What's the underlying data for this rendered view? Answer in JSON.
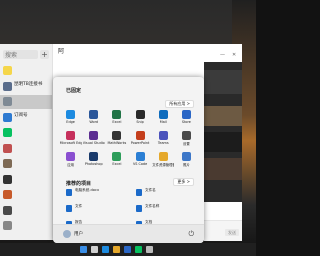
{
  "chat": {
    "search_placeholder": "搜索",
    "add_label": "+",
    "header_title": "阿",
    "send_label": "发送",
    "contacts": [
      {
        "name": "",
        "msg": "",
        "color": "#f5d64a"
      },
      {
        "name": "昆明TB连接书",
        "msg": "",
        "color": "#5a6d8c"
      },
      {
        "name": "",
        "msg": "",
        "color": "#7f8a95"
      },
      {
        "name": "订阅号",
        "msg": "",
        "color": "#2e7ad1"
      },
      {
        "name": "",
        "msg": "",
        "color": "#07c160"
      },
      {
        "name": "",
        "msg": "",
        "color": "#c05050"
      },
      {
        "name": "",
        "msg": "",
        "color": "#7e6a55"
      },
      {
        "name": "",
        "msg": "",
        "color": "#333333"
      },
      {
        "name": "",
        "msg": "",
        "color": "#c75a2a"
      },
      {
        "name": "",
        "msg": "",
        "color": "#4a4a4a"
      },
      {
        "name": "",
        "msg": "",
        "color": "#888888"
      }
    ]
  },
  "start_menu": {
    "pinned_label": "已固定",
    "all_apps_label": "所有应用 >",
    "pinned_apps": [
      {
        "label": "Edge",
        "color": "#1d8be0",
        "icon": "edge-icon"
      },
      {
        "label": "Word",
        "color": "#2b579a",
        "icon": "word-icon"
      },
      {
        "label": "Excel",
        "color": "#217346",
        "icon": "excel-icon"
      },
      {
        "label": "Snip",
        "color": "#2a2a2a",
        "icon": "snip-icon"
      },
      {
        "label": "Mail",
        "color": "#0f6cbd",
        "icon": "mail-icon"
      },
      {
        "label": "Store",
        "color": "#2b67c6",
        "icon": "store-icon"
      },
      {
        "label": "Microsoft Edge",
        "color": "#c6305c",
        "icon": "app-icon"
      },
      {
        "label": "Visual Studio",
        "color": "#5c2d91",
        "icon": "vs-icon"
      },
      {
        "label": "MathWorks",
        "color": "#343434",
        "icon": "app-icon"
      },
      {
        "label": "PowerPoint",
        "color": "#c43e1c",
        "icon": "powerpoint-icon"
      },
      {
        "label": "Teams",
        "color": "#4b53bc",
        "icon": "teams-icon"
      },
      {
        "label": "设置",
        "color": "#4a4a4a",
        "icon": "settings-icon"
      },
      {
        "label": "应用",
        "color": "#8a4fd0",
        "icon": "app-icon"
      },
      {
        "label": "Photoshop",
        "color": "#1a3a6b",
        "icon": "photoshop-icon"
      },
      {
        "label": "Excel",
        "color": "#2d9d5a",
        "icon": "excel-icon"
      },
      {
        "label": "VS Code",
        "color": "#2b7fd4",
        "icon": "vscode-icon"
      },
      {
        "label": "文件资源管理器",
        "color": "#e5a82b",
        "icon": "folder-icon"
      },
      {
        "label": "照片",
        "color": "#3d77c8",
        "icon": "photos-icon"
      }
    ],
    "recommended_label": "推荐的项目",
    "more_label": "更多 >",
    "recommended": [
      {
        "name": "电脑系统.docx",
        "time": ""
      },
      {
        "name": "文件名",
        "time": ""
      },
      {
        "name": "文件",
        "time": ""
      },
      {
        "name": "文件名称",
        "time": ""
      },
      {
        "name": "报告",
        "time": ""
      },
      {
        "name": "文档",
        "time": ""
      }
    ],
    "user_name": "用户",
    "power_glyph": "⏻"
  },
  "taskbar": {
    "icons": [
      {
        "name": "start-icon",
        "color": "#3a8ee6"
      },
      {
        "name": "search-icon",
        "color": "#d0d0d0"
      },
      {
        "name": "edge-icon",
        "color": "#1d8be0"
      },
      {
        "name": "folder-icon",
        "color": "#e5a82b"
      },
      {
        "name": "store-icon",
        "color": "#2b67c6"
      },
      {
        "name": "wechat-icon",
        "color": "#07c160"
      },
      {
        "name": "app-icon",
        "color": "#bbbbbb"
      }
    ]
  }
}
